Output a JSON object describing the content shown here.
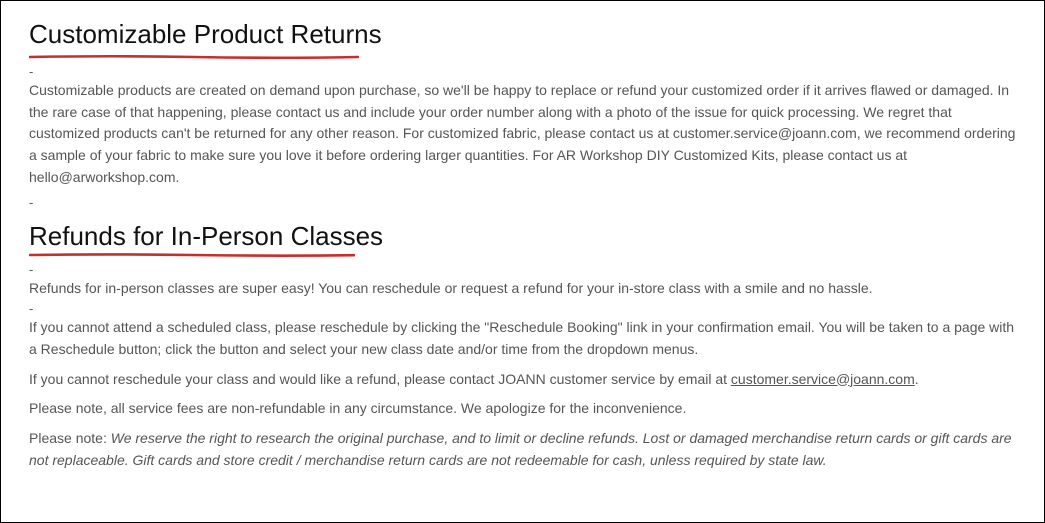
{
  "section1": {
    "heading": "Customizable Product Returns",
    "para1": "Customizable products are created on demand upon purchase, so we'll be happy to replace or refund your customized order if it arrives flawed or damaged. In the rare case of that happening, please contact us and include your order number along with a photo of the issue for quick processing. We regret that customized products can't be returned for any other reason.  For customized fabric, please contact us at customer.service@joann.com, we recommend ordering a sample of your fabric to make sure you love it before ordering larger quantities.  For AR Workshop DIY Customized Kits, please contact us at hello@arworkshop.com."
  },
  "section2": {
    "heading": "Refunds for In-Person Classes",
    "para1": "Refunds for in-person classes are super easy!  You can reschedule or request a refund for your in-store class with a smile and no hassle.",
    "para2": "If you cannot attend a scheduled class, please reschedule by clicking the \"Reschedule Booking\" link in your confirmation email.  You will be taken to a page with a Reschedule button; click the button and select your new class date and/or time from the dropdown menus.",
    "para3_pre": "If you cannot reschedule your class and would like a refund, please contact JOANN customer service by email at ",
    "para3_link": "customer.service@joann.com",
    "para3_post": ".",
    "para4": "Please note, all service fees are non-refundable in any circumstance. We apologize for the inconvenience.",
    "para5_pre": "Please note: ",
    "para5_italic": "We reserve the right to research the original purchase, and to limit or decline refunds. Lost or damaged merchandise return cards or gift cards are not replaceable. Gift cards and store credit / merchandise return cards are not redeemable for cash, unless required by state law."
  },
  "marks": {
    "dash": "-"
  }
}
